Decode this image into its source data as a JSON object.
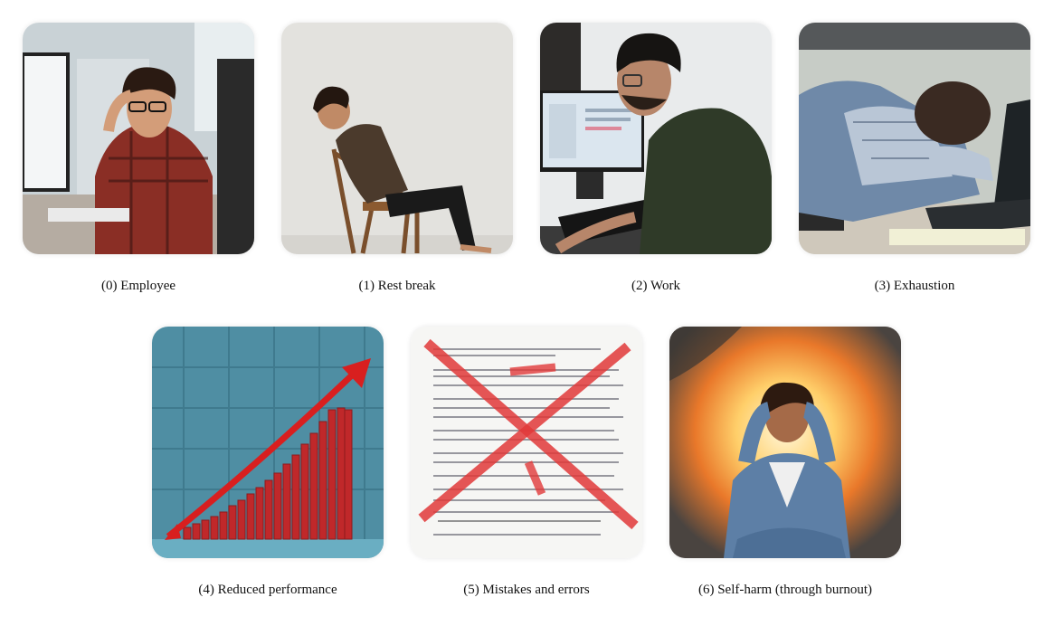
{
  "figure": {
    "items": [
      {
        "caption": "(0) Employee",
        "image": "employee-at-computer-photo"
      },
      {
        "caption": "(1) Rest break",
        "image": "rest-break-chair-photo"
      },
      {
        "caption": "(2) Work",
        "image": "working-at-keyboard-photo"
      },
      {
        "caption": "(3) Exhaustion",
        "image": "exhausted-on-desk-photo"
      },
      {
        "caption": "(4) Reduced performance",
        "image": "declining-bar-chart-arrow-image"
      },
      {
        "caption": "(5) Mistakes and errors",
        "image": "crossed-out-document-image"
      },
      {
        "caption": "(6) Self-harm (through burnout)",
        "image": "burnout-fire-photo"
      }
    ]
  }
}
